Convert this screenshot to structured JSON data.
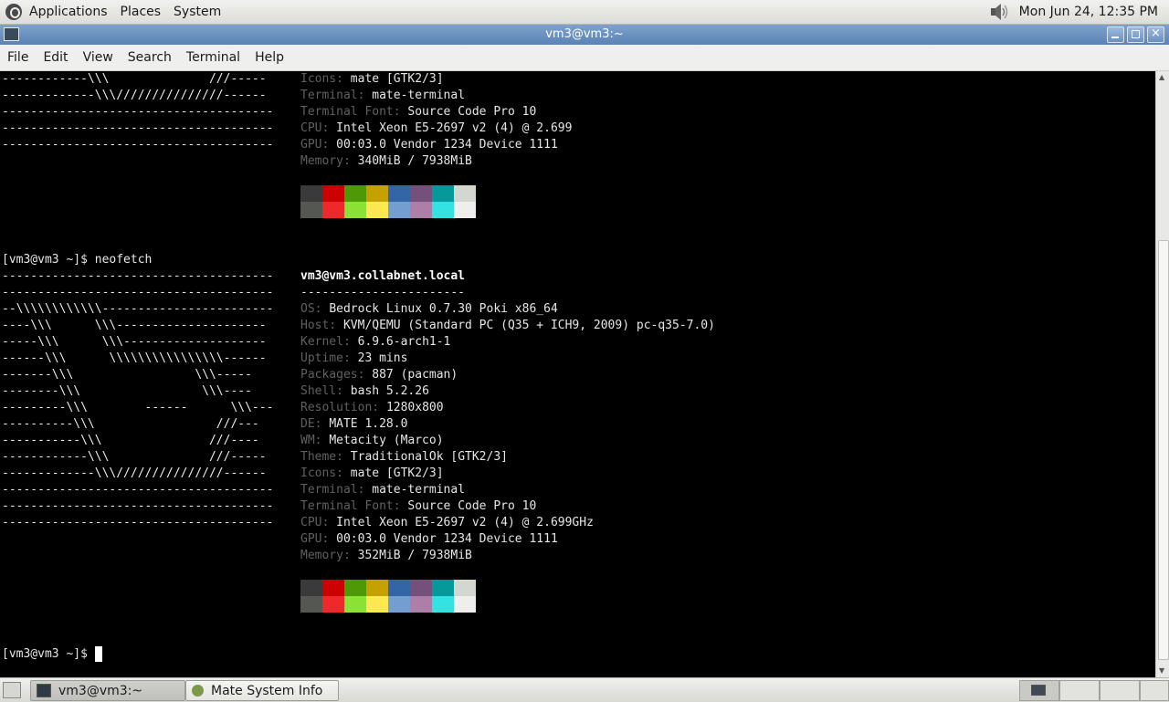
{
  "top_panel": {
    "menus": [
      "Applications",
      "Places",
      "System"
    ],
    "clock": "Mon Jun 24, 12:35 PM"
  },
  "window": {
    "title": "vm3@vm3:~",
    "menus": [
      "File",
      "Edit",
      "View",
      "Search",
      "Terminal",
      "Help"
    ]
  },
  "terminal": {
    "top_logo_lines": [
      "------------\\\\\\              ///-----",
      "-------------\\\\\\///////////////------",
      "--------------------------------------",
      "--------------------------------------",
      "--------------------------------------"
    ],
    "top_info": [
      {
        "key": "Icons",
        "value": "mate [GTK2/3]"
      },
      {
        "key": "Terminal",
        "value": "mate-terminal"
      },
      {
        "key": "Terminal Font",
        "value": "Source Code Pro 10"
      },
      {
        "key": "CPU",
        "value": "Intel Xeon E5-2697 v2 (4) @ 2.699"
      },
      {
        "key": "GPU",
        "value": "00:03.0 Vendor 1234 Device 1111"
      },
      {
        "key": "Memory",
        "value": "340MiB / 7938MiB"
      }
    ],
    "prompt1": "[vm3@vm3 ~]$ neofetch",
    "user_host": "vm3@vm3.collabnet.local",
    "separator": "-----------------------",
    "logo_lines": [
      "--------------------------------------",
      "--------------------------------------",
      "--\\\\\\\\\\\\\\\\\\\\\\\\------------------------",
      "----\\\\\\      \\\\\\---------------------",
      "-----\\\\\\      \\\\\\--------------------",
      "------\\\\\\      \\\\\\\\\\\\\\\\\\\\\\\\\\\\\\\\------",
      "-------\\\\\\                 \\\\\\-----",
      "--------\\\\\\                 \\\\\\----",
      "---------\\\\\\        ------      \\\\\\---",
      "----------\\\\\\                 ///---",
      "-----------\\\\\\               ///----",
      "------------\\\\\\              ///-----",
      "-------------\\\\\\///////////////------",
      "--------------------------------------",
      "--------------------------------------",
      "--------------------------------------"
    ],
    "info": [
      {
        "key": "OS",
        "value": "Bedrock Linux 0.7.30 Poki x86_64"
      },
      {
        "key": "Host",
        "value": "KVM/QEMU (Standard PC (Q35 + ICH9, 2009) pc-q35-7.0)"
      },
      {
        "key": "Kernel",
        "value": "6.9.6-arch1-1"
      },
      {
        "key": "Uptime",
        "value": "23 mins"
      },
      {
        "key": "Packages",
        "value": "887 (pacman)"
      },
      {
        "key": "Shell",
        "value": "bash 5.2.26"
      },
      {
        "key": "Resolution",
        "value": "1280x800"
      },
      {
        "key": "DE",
        "value": "MATE 1.28.0"
      },
      {
        "key": "WM",
        "value": "Metacity (Marco)"
      },
      {
        "key": "Theme",
        "value": "TraditionalOk [GTK2/3]"
      },
      {
        "key": "Icons",
        "value": "mate [GTK2/3]"
      },
      {
        "key": "Terminal",
        "value": "mate-terminal"
      },
      {
        "key": "Terminal Font",
        "value": "Source Code Pro 10"
      },
      {
        "key": "CPU",
        "value": "Intel Xeon E5-2697 v2 (4) @ 2.699GHz"
      },
      {
        "key": "GPU",
        "value": "00:03.0 Vendor 1234 Device 1111"
      },
      {
        "key": "Memory",
        "value": "352MiB / 7938MiB"
      }
    ],
    "palette_dark": [
      "#3a3a3a",
      "#cc0000",
      "#4e9a06",
      "#c4a000",
      "#3465a4",
      "#75507b",
      "#06989a",
      "#d3d7cf"
    ],
    "palette_light": [
      "#555753",
      "#ef2929",
      "#8ae234",
      "#fce94f",
      "#729fcf",
      "#ad7fa8",
      "#34e2e2",
      "#eeeeec"
    ],
    "prompt2": "[vm3@vm3 ~]$ "
  },
  "taskbar": {
    "tasks": [
      "vm3@vm3:~",
      "Mate System Info"
    ]
  }
}
